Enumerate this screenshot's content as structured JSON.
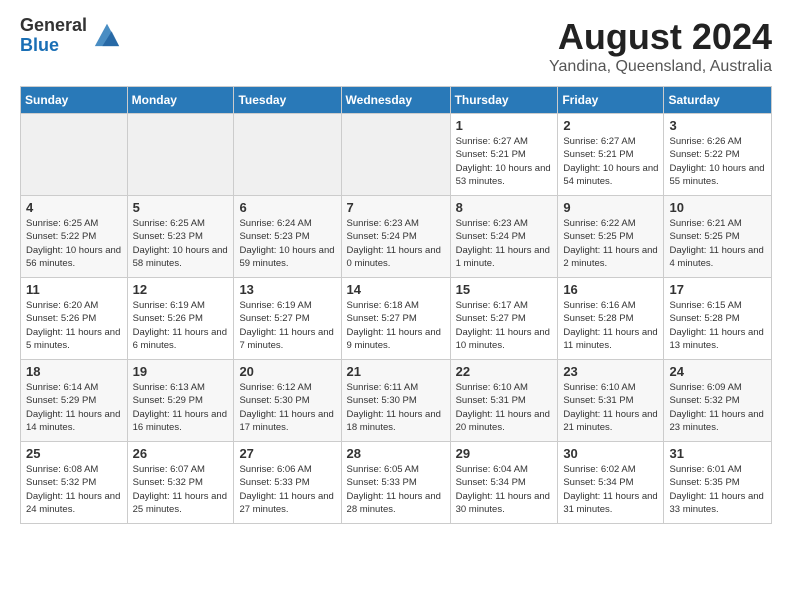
{
  "header": {
    "logo": {
      "general": "General",
      "blue": "Blue"
    },
    "month_year": "August 2024",
    "location": "Yandina, Queensland, Australia"
  },
  "weekdays": [
    "Sunday",
    "Monday",
    "Tuesday",
    "Wednesday",
    "Thursday",
    "Friday",
    "Saturday"
  ],
  "weeks": [
    [
      {
        "day": "",
        "info": ""
      },
      {
        "day": "",
        "info": ""
      },
      {
        "day": "",
        "info": ""
      },
      {
        "day": "",
        "info": ""
      },
      {
        "day": "1",
        "info": "Sunrise: 6:27 AM\nSunset: 5:21 PM\nDaylight: 10 hours\nand 53 minutes."
      },
      {
        "day": "2",
        "info": "Sunrise: 6:27 AM\nSunset: 5:21 PM\nDaylight: 10 hours\nand 54 minutes."
      },
      {
        "day": "3",
        "info": "Sunrise: 6:26 AM\nSunset: 5:22 PM\nDaylight: 10 hours\nand 55 minutes."
      }
    ],
    [
      {
        "day": "4",
        "info": "Sunrise: 6:25 AM\nSunset: 5:22 PM\nDaylight: 10 hours\nand 56 minutes."
      },
      {
        "day": "5",
        "info": "Sunrise: 6:25 AM\nSunset: 5:23 PM\nDaylight: 10 hours\nand 58 minutes."
      },
      {
        "day": "6",
        "info": "Sunrise: 6:24 AM\nSunset: 5:23 PM\nDaylight: 10 hours\nand 59 minutes."
      },
      {
        "day": "7",
        "info": "Sunrise: 6:23 AM\nSunset: 5:24 PM\nDaylight: 11 hours\nand 0 minutes."
      },
      {
        "day": "8",
        "info": "Sunrise: 6:23 AM\nSunset: 5:24 PM\nDaylight: 11 hours\nand 1 minute."
      },
      {
        "day": "9",
        "info": "Sunrise: 6:22 AM\nSunset: 5:25 PM\nDaylight: 11 hours\nand 2 minutes."
      },
      {
        "day": "10",
        "info": "Sunrise: 6:21 AM\nSunset: 5:25 PM\nDaylight: 11 hours\nand 4 minutes."
      }
    ],
    [
      {
        "day": "11",
        "info": "Sunrise: 6:20 AM\nSunset: 5:26 PM\nDaylight: 11 hours\nand 5 minutes."
      },
      {
        "day": "12",
        "info": "Sunrise: 6:19 AM\nSunset: 5:26 PM\nDaylight: 11 hours\nand 6 minutes."
      },
      {
        "day": "13",
        "info": "Sunrise: 6:19 AM\nSunset: 5:27 PM\nDaylight: 11 hours\nand 7 minutes."
      },
      {
        "day": "14",
        "info": "Sunrise: 6:18 AM\nSunset: 5:27 PM\nDaylight: 11 hours\nand 9 minutes."
      },
      {
        "day": "15",
        "info": "Sunrise: 6:17 AM\nSunset: 5:27 PM\nDaylight: 11 hours\nand 10 minutes."
      },
      {
        "day": "16",
        "info": "Sunrise: 6:16 AM\nSunset: 5:28 PM\nDaylight: 11 hours\nand 11 minutes."
      },
      {
        "day": "17",
        "info": "Sunrise: 6:15 AM\nSunset: 5:28 PM\nDaylight: 11 hours\nand 13 minutes."
      }
    ],
    [
      {
        "day": "18",
        "info": "Sunrise: 6:14 AM\nSunset: 5:29 PM\nDaylight: 11 hours\nand 14 minutes."
      },
      {
        "day": "19",
        "info": "Sunrise: 6:13 AM\nSunset: 5:29 PM\nDaylight: 11 hours\nand 16 minutes."
      },
      {
        "day": "20",
        "info": "Sunrise: 6:12 AM\nSunset: 5:30 PM\nDaylight: 11 hours\nand 17 minutes."
      },
      {
        "day": "21",
        "info": "Sunrise: 6:11 AM\nSunset: 5:30 PM\nDaylight: 11 hours\nand 18 minutes."
      },
      {
        "day": "22",
        "info": "Sunrise: 6:10 AM\nSunset: 5:31 PM\nDaylight: 11 hours\nand 20 minutes."
      },
      {
        "day": "23",
        "info": "Sunrise: 6:10 AM\nSunset: 5:31 PM\nDaylight: 11 hours\nand 21 minutes."
      },
      {
        "day": "24",
        "info": "Sunrise: 6:09 AM\nSunset: 5:32 PM\nDaylight: 11 hours\nand 23 minutes."
      }
    ],
    [
      {
        "day": "25",
        "info": "Sunrise: 6:08 AM\nSunset: 5:32 PM\nDaylight: 11 hours\nand 24 minutes."
      },
      {
        "day": "26",
        "info": "Sunrise: 6:07 AM\nSunset: 5:32 PM\nDaylight: 11 hours\nand 25 minutes."
      },
      {
        "day": "27",
        "info": "Sunrise: 6:06 AM\nSunset: 5:33 PM\nDaylight: 11 hours\nand 27 minutes."
      },
      {
        "day": "28",
        "info": "Sunrise: 6:05 AM\nSunset: 5:33 PM\nDaylight: 11 hours\nand 28 minutes."
      },
      {
        "day": "29",
        "info": "Sunrise: 6:04 AM\nSunset: 5:34 PM\nDaylight: 11 hours\nand 30 minutes."
      },
      {
        "day": "30",
        "info": "Sunrise: 6:02 AM\nSunset: 5:34 PM\nDaylight: 11 hours\nand 31 minutes."
      },
      {
        "day": "31",
        "info": "Sunrise: 6:01 AM\nSunset: 5:35 PM\nDaylight: 11 hours\nand 33 minutes."
      }
    ]
  ]
}
